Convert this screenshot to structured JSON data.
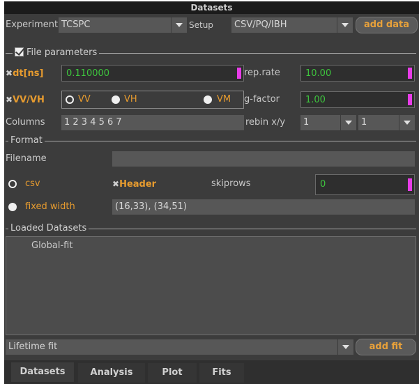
{
  "window": {
    "title": "Datasets"
  },
  "top_row": {
    "experiment_label": "Experiment",
    "experiment_value": "TCSPC",
    "setup_label": "Setup",
    "setup_value": "CSV/PQ/IBH",
    "add_data_label": "add data"
  },
  "file_parameters": {
    "title": "File parameters",
    "checked": true,
    "dt_label": "dt[ns]",
    "dt_value": "0.110000",
    "reprate_label": "rep.rate",
    "reprate_value": "10.00",
    "vvvh_label": "VV/VH",
    "vv_label": "VV",
    "vh_label": "VH",
    "vm_label": "VM",
    "gfactor_label": "g-factor",
    "gfactor_value": "1.00",
    "columns_label": "Columns",
    "columns_value": "1 2 3 4 5 6 7",
    "rebin_label": "rebin x/y",
    "rebin_x": "1",
    "rebin_y": "1"
  },
  "format": {
    "title": "Format",
    "filename_label": "Filename",
    "filename_value": "",
    "csv_label": "csv",
    "header_label": "Header",
    "skiprows_label": "skiprows",
    "skiprows_value": "0",
    "fixed_width_label": "fixed width",
    "fixed_width_value": "(16,33), (34,51)"
  },
  "loaded_datasets": {
    "title": "Loaded Datasets",
    "items": [
      "Global-fit"
    ]
  },
  "bottom_row": {
    "fit_value": "Lifetime fit",
    "add_fit_label": "add fit"
  },
  "tabs": [
    {
      "label": "Datasets",
      "active": true
    },
    {
      "label": "Analysis",
      "active": false
    },
    {
      "label": "Plot",
      "active": false
    },
    {
      "label": "Fits",
      "active": false
    }
  ],
  "colors": {
    "panel_bg": "#3c3c3c",
    "accent_orange": "#e69b2f",
    "value_green": "#3ec43e",
    "spin_handle": "#e83ce8"
  }
}
